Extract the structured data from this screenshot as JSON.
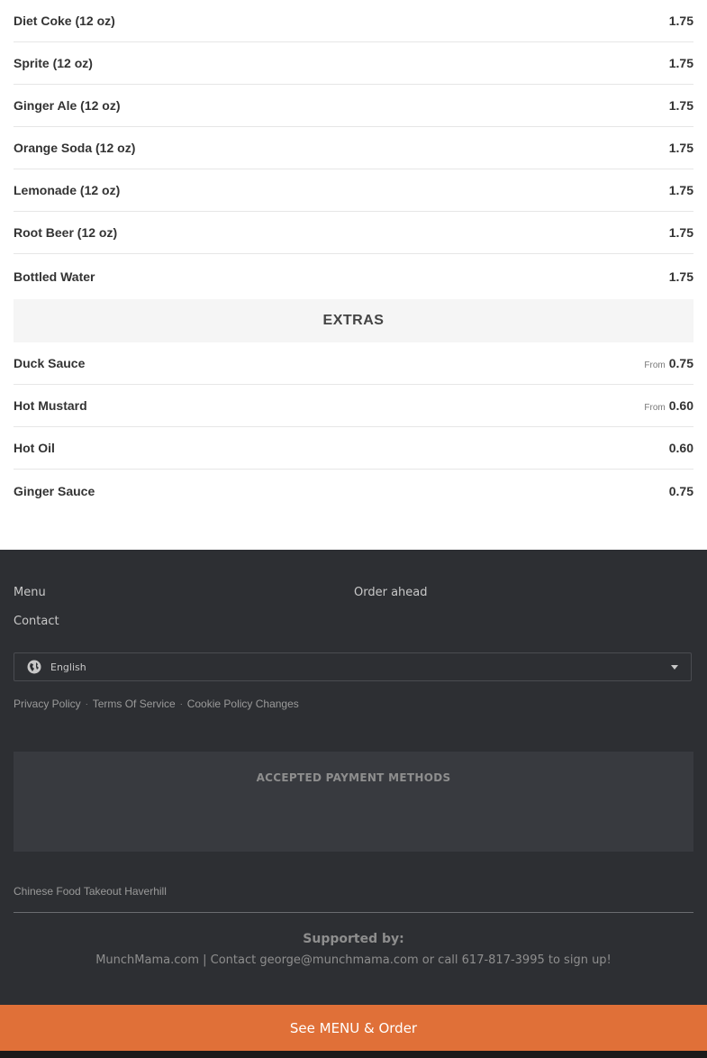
{
  "drinks": [
    {
      "name": "Diet Coke (12 oz)",
      "price": "1.75"
    },
    {
      "name": "Sprite (12 oz)",
      "price": "1.75"
    },
    {
      "name": "Ginger Ale (12 oz)",
      "price": "1.75"
    },
    {
      "name": "Orange Soda (12 oz)",
      "price": "1.75"
    },
    {
      "name": "Lemonade (12 oz)",
      "price": "1.75"
    },
    {
      "name": "Root Beer (12 oz)",
      "price": "1.75"
    },
    {
      "name": "Bottled Water",
      "price": "1.75"
    }
  ],
  "extras": {
    "title": "EXTRAS",
    "items": [
      {
        "name": "Duck Sauce",
        "from": "From",
        "price": "0.75"
      },
      {
        "name": "Hot Mustard",
        "from": "From",
        "price": "0.60"
      },
      {
        "name": "Hot Oil",
        "price": "0.60"
      },
      {
        "name": "Ginger Sauce",
        "price": "0.75"
      }
    ]
  },
  "footer": {
    "nav": {
      "menu": "Menu",
      "order_ahead": "Order ahead",
      "contact": "Contact"
    },
    "language": {
      "selected": "English",
      "icon": "globe-icon"
    },
    "legal": {
      "privacy": "Privacy Policy",
      "terms": "Terms Of Service",
      "cookie": "Cookie Policy Changes",
      "separator": "·"
    },
    "payments_title": "ACCEPTED PAYMENT METHODS",
    "tagline": "Chinese Food Takeout Haverhill",
    "supported_by": "Supported by:",
    "contact_line": "MunchMama.com | Contact george@munchmama.com or call 617-817-3995 to sign up!"
  },
  "cta": {
    "label": "See MENU & Order"
  },
  "colors": {
    "accent": "#e07038",
    "footer_bg": "#2d2f33"
  }
}
